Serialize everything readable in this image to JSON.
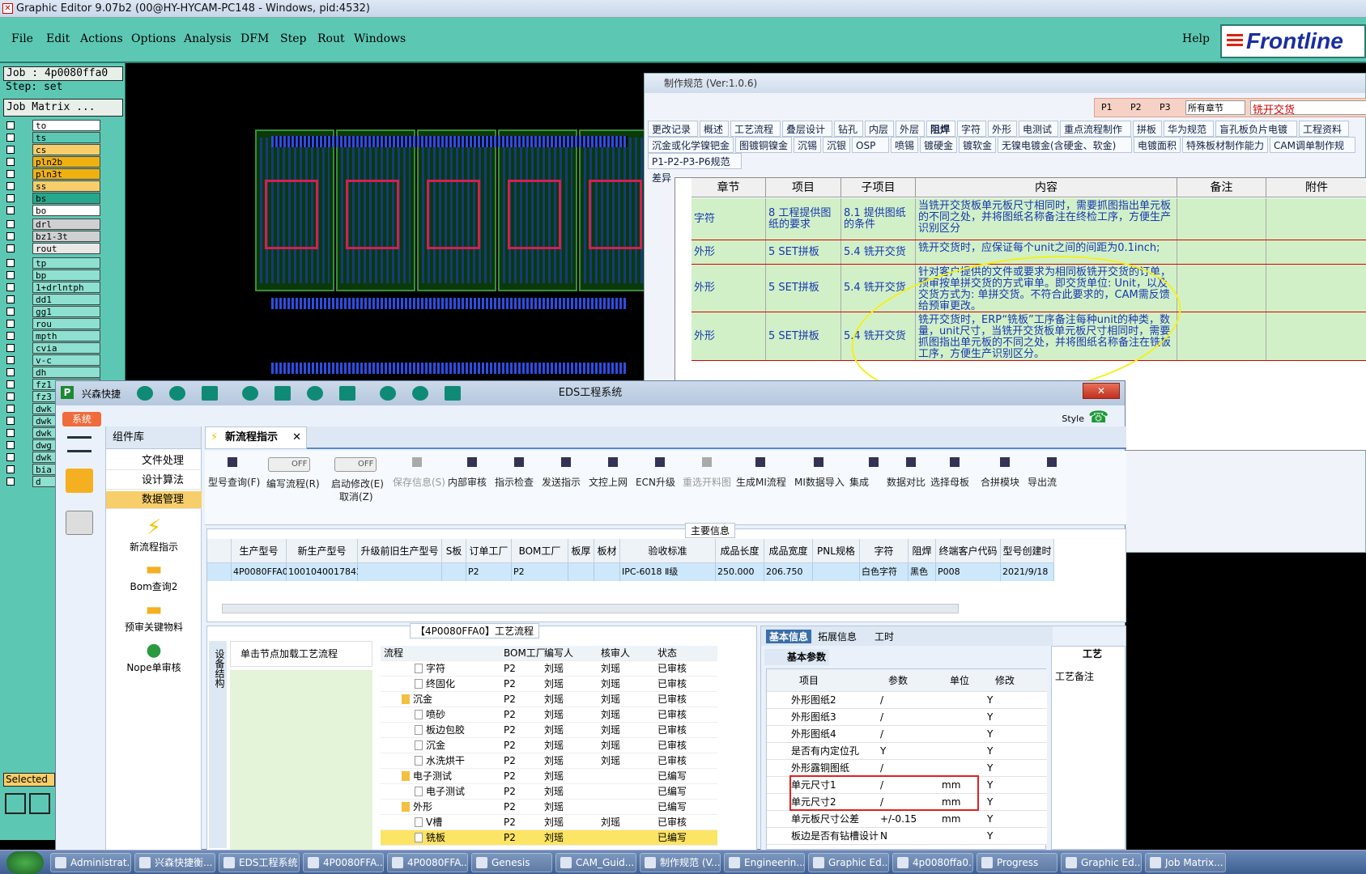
{
  "ge": {
    "title": "Graphic Editor 9.07b2 (00@HY-HYCAM-PC148 - Windows, pid:4532)",
    "menu": [
      "File",
      "Edit",
      "Actions",
      "Options",
      "Analysis",
      "DFM",
      "Step",
      "Rout",
      "Windows"
    ],
    "help": "Help",
    "brand": "Frontline",
    "job": "Job : 4p0080ffa0",
    "step": "Step: set",
    "matrix": "Job Matrix ...",
    "selected": "Selected",
    "layers": [
      {
        "n": "to",
        "c": "#ffffff"
      },
      {
        "n": "ts",
        "c": "#5cc8b4"
      },
      {
        "n": "cs",
        "c": "#f7ce6a"
      },
      {
        "n": "pln2b",
        "c": "#f0b010"
      },
      {
        "n": "pln3t",
        "c": "#f0b010"
      },
      {
        "n": "ss",
        "c": "#f7ce6a"
      },
      {
        "n": "bs",
        "c": "#27a88c"
      },
      {
        "n": "bo",
        "c": "#ffffff"
      },
      {
        "n": "drl",
        "c": "#d0d0d0"
      },
      {
        "n": "bz1-3t",
        "c": "#d0d0d0"
      },
      {
        "n": "rout",
        "c": "#e8e8e8"
      },
      {
        "n": "tp",
        "c": "#8ee0d0"
      },
      {
        "n": "bp",
        "c": "#8ee0d0"
      },
      {
        "n": "1+drlntph",
        "c": "#8ee0d0"
      },
      {
        "n": "dd1",
        "c": "#8ee0d0"
      },
      {
        "n": "gg1",
        "c": "#8ee0d0"
      },
      {
        "n": "rou",
        "c": "#8ee0d0"
      },
      {
        "n": "mpth",
        "c": "#8ee0d0"
      },
      {
        "n": "cvia",
        "c": "#8ee0d0"
      },
      {
        "n": "v-c",
        "c": "#8ee0d0"
      },
      {
        "n": "dh",
        "c": "#8ee0d0"
      },
      {
        "n": "fz1",
        "c": "#8ee0d0"
      },
      {
        "n": "fz3",
        "c": "#8ee0d0"
      },
      {
        "n": "dwk",
        "c": "#8ee0d0"
      },
      {
        "n": "dwk",
        "c": "#8ee0d0"
      },
      {
        "n": "dwk",
        "c": "#8ee0d0"
      },
      {
        "n": "dwg",
        "c": "#8ee0d0"
      },
      {
        "n": "dwk",
        "c": "#8ee0d0"
      },
      {
        "n": "bia",
        "c": "#8ee0d0"
      },
      {
        "n": "d",
        "c": "#8ee0d0"
      }
    ]
  },
  "spec": {
    "title": "制作规范 (Ver:1.0.6)",
    "filter": {
      "p1": "P1",
      "p2": "P2",
      "p3": "P3",
      "chapter": "所有章节",
      "search": "铣开交货"
    },
    "tabs1": [
      "更改记录",
      "概述",
      "工艺流程",
      "叠层设计",
      "钻孔",
      "内层",
      "外层",
      "阻焊",
      "字符",
      "外形",
      "电测试",
      "重点流程制作",
      "拼板",
      "华为规范",
      "盲孔板负片电镀",
      "工程资料"
    ],
    "tabs2": [
      "沉金或化学镍钯金",
      "图镀铜镍金",
      "沉锡",
      "沉银",
      "OSP",
      "喷锡",
      "镀硬金",
      "镀软金",
      "无镍电镀金(含硬金、软金)",
      "电镀面积",
      "特殊板材制作能力",
      "CAM调单制作规"
    ],
    "tabs3": [
      "P1-P2-P3-P6规范差异"
    ],
    "headers": [
      "章节",
      "项目",
      "子项目",
      "内容",
      "备注",
      "附件"
    ],
    "rows": [
      {
        "a": "字符",
        "b": "8 工程提供图纸的要求",
        "c": "8.1 提供图纸的条件",
        "d": "当铣开交货板单元板尺寸相同时，需要抓图指出单元板的不同之处，并将图纸名称备注在终检工序，方便生产识别区分"
      },
      {
        "a": "外形",
        "b": "5 SET拼板",
        "c": "5.4 铣开交货",
        "d": "铣开交货时，应保证每个unit之间的间距为0.1inch;"
      },
      {
        "a": "外形",
        "b": "5 SET拼板",
        "c": "5.4 铣开交货",
        "d": "针对客户提供的文件或要求为相同板铣开交货的订单，预审按单拼交货的方式审单。即交货单位: Unit，以及交货方式为: 单拼交货。不符合此要求的，CAM需反馈给预审更改。"
      },
      {
        "a": "外形",
        "b": "5 SET拼板",
        "c": "5.4 铣开交货",
        "d": "铣开交货时，ERP“铣板”工序备注每种unit的种类，数量，unit尺寸，当铣开交货板单元板尺寸相同时，需要抓图指出单元板的不同之处，并将图纸名称备注在铣板工序，方便生产识别区分。"
      }
    ]
  },
  "eds": {
    "app": "兴森快捷",
    "title": "EDS工程系统",
    "sys": "系统",
    "style": "Style",
    "comp_title": "组件库",
    "comp_items": [
      "文件处理",
      "设计算法",
      "数据管理"
    ],
    "comp_icons": [
      "新流程指示",
      "Bom查询2",
      "预审关键物料",
      "Nope单审核"
    ],
    "tab": "新流程指示",
    "ribbon": [
      {
        "l": "型号查询(F)",
        "d": false
      },
      {
        "l": "保存信息(S)",
        "d": true
      },
      {
        "l": "内部审核",
        "d": false
      },
      {
        "l": "指示检查",
        "d": false
      },
      {
        "l": "发送指示",
        "d": false
      },
      {
        "l": "文控上网",
        "d": false
      },
      {
        "l": "ECN升级",
        "d": false
      },
      {
        "l": "重选开料图",
        "d": true
      },
      {
        "l": "生成MI流程",
        "d": false
      },
      {
        "l": "MI数据导入",
        "d": false
      },
      {
        "l": "集成",
        "d": false
      },
      {
        "l": "数据对比",
        "d": false
      },
      {
        "l": "选择母板",
        "d": false
      },
      {
        "l": "合拼模块",
        "d": false
      },
      {
        "l": "导出流",
        "d": false
      }
    ],
    "toggle1": {
      "state": "OFF",
      "label": "编写流程(R)"
    },
    "toggle2": {
      "state": "OFF",
      "label": "启动修改(E)",
      "sub": "取消(Z)"
    },
    "main_info": "主要信息",
    "g1h": [
      "生产型号",
      "新生产型号",
      "升级前旧生产型号",
      "S板",
      "订单工厂",
      "BOM工厂",
      "板厚",
      "板材",
      "验收标准",
      "成品长度",
      "成品宽度",
      "PNL规格",
      "字符",
      "阻焊",
      "终端客户代码",
      "型号创建时"
    ],
    "g1r": [
      "4P0080FFA0",
      "10010400178437",
      "",
      "",
      "P2",
      "P2",
      "",
      "",
      "IPC-6018 Ⅱ级",
      "250.000",
      "206.750",
      "",
      "白色字符",
      "黑色",
      "P008",
      "2021/9/18"
    ],
    "flow_title": "【4P0080FFA0】工艺流程",
    "flow_hint": "单击节点加载工艺流程",
    "side_label": "设备结构",
    "fh": [
      "流程",
      "BOM工厂",
      "编写人",
      "核审人",
      "状态"
    ],
    "fr": [
      [
        "字符",
        "P2",
        "刘瑶",
        "刘瑶",
        "已审核",
        1
      ],
      [
        "终固化",
        "P2",
        "刘瑶",
        "刘瑶",
        "已审核",
        1
      ],
      [
        "沉金",
        "P2",
        "刘瑶",
        "刘瑶",
        "已审核",
        0
      ],
      [
        "喷砂",
        "P2",
        "刘瑶",
        "刘瑶",
        "已审核",
        1
      ],
      [
        "板边包胶",
        "P2",
        "刘瑶",
        "刘瑶",
        "已审核",
        1
      ],
      [
        "沉金",
        "P2",
        "刘瑶",
        "刘瑶",
        "已审核",
        1
      ],
      [
        "水洗烘干",
        "P2",
        "刘瑶",
        "刘瑶",
        "已审核",
        1
      ],
      [
        "电子测试",
        "P2",
        "刘瑶",
        "",
        "已编写",
        0
      ],
      [
        "电子测试",
        "P2",
        "刘瑶",
        "",
        "已编写",
        1
      ],
      [
        "外形",
        "P2",
        "刘瑶",
        "",
        "已编写",
        0
      ],
      [
        "V槽",
        "P2",
        "刘瑶",
        "刘瑶",
        "已审核",
        1
      ],
      [
        "铣板",
        "P2",
        "刘瑶",
        "",
        "已编写",
        1
      ]
    ],
    "btabs": [
      "基本信息",
      "拓展信息",
      "工时"
    ],
    "bsub": "基本参数",
    "gy": "工艺",
    "gy_note": "工艺备注",
    "bh": [
      "项目",
      "参数",
      "单位",
      "修改"
    ],
    "br": [
      [
        "外形图纸2",
        "/",
        "",
        "Y"
      ],
      [
        "外形图纸3",
        "/",
        "",
        "Y"
      ],
      [
        "外形图纸4",
        "/",
        "",
        "Y"
      ],
      [
        "是否有内定位孔",
        "Y",
        "",
        "Y"
      ],
      [
        "外形露铜图纸",
        "/",
        "",
        "Y"
      ],
      [
        "单元尺寸1",
        "/",
        "mm",
        "Y"
      ],
      [
        "单元尺寸2",
        "/",
        "mm",
        "Y"
      ],
      [
        "单元板尺寸公差",
        "+/-0.15",
        "mm",
        "Y"
      ],
      [
        "板边是否有钻槽设计",
        "N",
        "",
        "Y"
      ]
    ]
  },
  "taskbar": [
    "Administrat...",
    "兴森快捷衡...",
    "EDS工程系统",
    "4P0080FFA...",
    "4P0080FFA...",
    "Genesis",
    "CAM_Guid...",
    "制作规范 (V...",
    "Engineerin...",
    "Graphic Ed...",
    "4p0080ffa0...",
    "Progress",
    "Graphic Ed...",
    "Job Matrix..."
  ]
}
